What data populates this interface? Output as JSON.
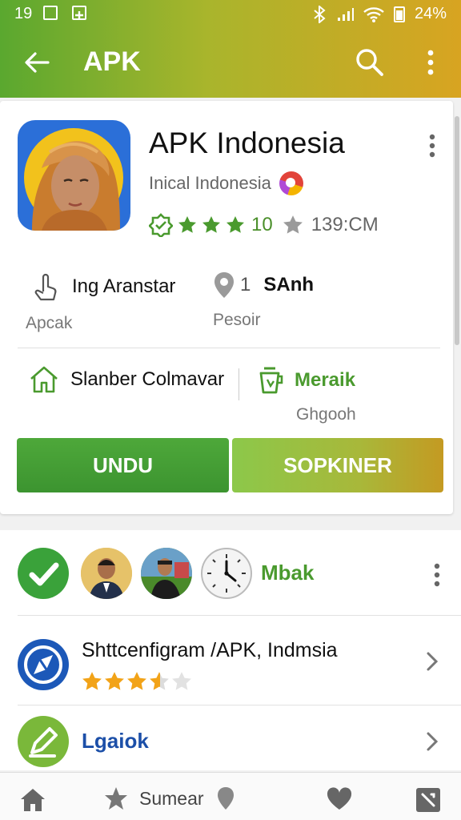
{
  "status_bar": {
    "time": "19",
    "right_text": "24%"
  },
  "app_bar": {
    "title": "APK"
  },
  "app": {
    "name": "APK Indonesia",
    "developer": "Inical Indonesia",
    "rating_value": "10",
    "size": "139:CM",
    "stars_filled": 3
  },
  "info_row_1": {
    "left_label": "Ing Aranstar",
    "left_sub": "Apcak",
    "right_label": "SAnh",
    "right_prefix": "1",
    "right_sub": "Pesoir"
  },
  "info_row_2": {
    "left_label": "Slanber Colmavar",
    "right_label": "Meraik",
    "right_sub": "Ghgooh"
  },
  "buttons": {
    "download": "UNDU",
    "secondary": "SOPKINER"
  },
  "list": {
    "row1_label": "Mbak",
    "row2_label": "Shttcenfigram /APK, Indmsia",
    "row2_stars": 3.5,
    "row3_label": "Lgaiok"
  },
  "bottom_nav": {
    "center_label": "Sumear"
  },
  "colors": {
    "accent_green": "#4a9a2e",
    "gradient_end": "#d8a421",
    "link_blue": "#1c4fa8"
  },
  "icons": [
    "arrow-back-icon",
    "search-icon",
    "more-vert-icon",
    "touch-icon",
    "location-pin-icon",
    "home-icon",
    "cup-icon",
    "check-icon",
    "clock-icon",
    "compass-icon",
    "chevron-right-icon",
    "star-icon",
    "heart-icon",
    "wrench-icon"
  ]
}
